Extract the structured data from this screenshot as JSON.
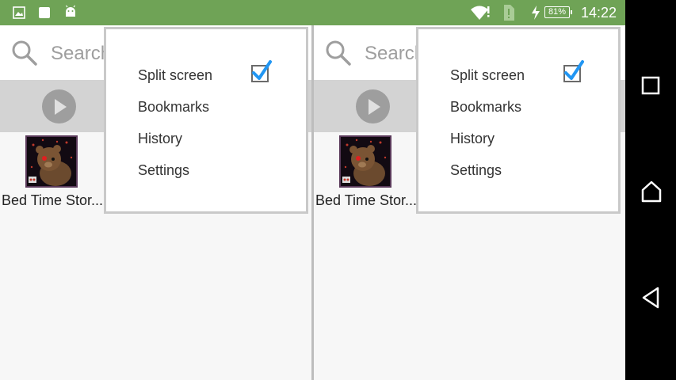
{
  "status_bar": {
    "time": "14:22",
    "battery": "81%",
    "icons": [
      "image-icon",
      "stop-square-icon",
      "android-icon",
      "wifi-icon",
      "sim-icon",
      "charging-icon"
    ]
  },
  "colors": {
    "status_bar": "#6fa356",
    "checkbox_check": "#2196f3",
    "divider": "#bdbdbd"
  },
  "left_pane": {
    "search_placeholder": "Search",
    "app_label": "Bed Time Stor...",
    "menu": {
      "items": [
        "Split screen",
        "Bookmarks",
        "History",
        "Settings"
      ],
      "split_screen_checked": true
    }
  },
  "right_pane": {
    "search_placeholder": "Search",
    "app_label": "Bed Time Stor...",
    "menu": {
      "items": [
        "Split screen",
        "Bookmarks",
        "History",
        "Settings"
      ],
      "split_screen_checked": true
    }
  },
  "nav_bar": {
    "buttons": [
      "recents-icon",
      "home-icon",
      "back-icon"
    ]
  }
}
